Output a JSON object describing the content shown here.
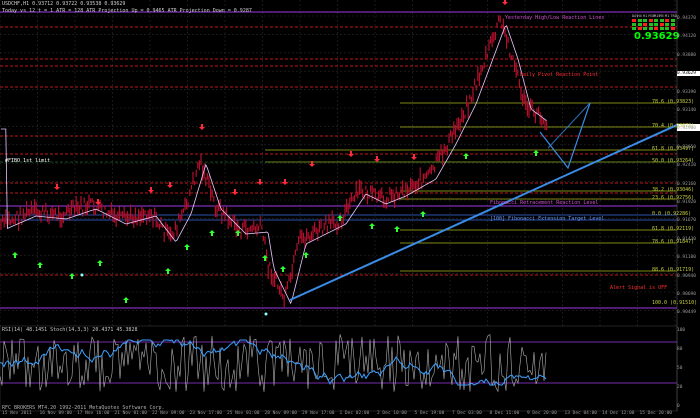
{
  "chart": {
    "title": "USDCHF,H1  0.93712 0.93722 0.93538 0.93629",
    "indicator_line": "Today vs 12 t = 1    ATR = 128    ATR Projection Up = 0.9465    ATR Projection Down = 0.9287",
    "big_price": "0.93629",
    "oscillator_label": "RSI(14) 48.1451  Stoch(14,3,3) 20.4371 45.3828",
    "footer_text": "RFC BROKERS MT4.20 1992-2011 MetaQuotes Software Corp.",
    "alert_text": "Alert Signal is OFF",
    "panel_labels": [
      "DAY",
      "H4",
      "H1",
      "M30",
      "M15",
      "M5",
      "M1",
      "TRD"
    ],
    "annotations": {
      "top": "Yesterday High/Low Reaction Lines",
      "mid1": "Daily Pivot Reaction Point",
      "fib_label": "#FIBO 1st limit",
      "lower_box": "Fibonacci Retracement Reaction Level",
      "lower_box2": "[100] Fibonacci Extension Target Level"
    },
    "fib_levels": [
      {
        "label": "78.6 (0.93823)"
      },
      {
        "label": "70.4 (0.93673)"
      },
      {
        "label": "61.8 (0.93497)"
      },
      {
        "label": "50.0 (0.93264)"
      },
      {
        "label": "38.2 (0.93046)"
      },
      {
        "label": "23.6 (0.92756)"
      },
      {
        "label": "0.0 (0.92286)"
      },
      {
        "label": "61.8 (0.92119)"
      },
      {
        "label": "78.6 (0.91847)"
      },
      {
        "label": "88.6 (0.91719)"
      },
      {
        "label": "100.0 (0.91510)"
      }
    ]
  },
  "price_axis": [
    "0.94370",
    "0.94120",
    "0.93880",
    "0.93629",
    "0.93390",
    "0.93140",
    "0.92900",
    "0.92650",
    "0.92410",
    "0.92160",
    "0.91920",
    "0.91670",
    "0.91430",
    "0.91180",
    "0.90940",
    "0.90690",
    "0.90449"
  ],
  "osc_axis": [
    "100",
    "80",
    "50",
    "20",
    "0"
  ],
  "time_axis": [
    "15 Nov 2011",
    "16 Nov 09:00",
    "17 Nov 16:00",
    "21 Nov 01:00",
    "22 Nov 09:00",
    "23 Nov 17:00",
    "25 Nov 01:00",
    "28 Nov 09:00",
    "29 Nov 17:00",
    "1 Dec 02:00",
    "2 Dec 10:00",
    "5 Dec 19:00",
    "7 Dec 03:00",
    "8 Dec 11:00",
    "9 Dec 20:00",
    "13 Dec 04:00",
    "14 Dec 12:00",
    "15 Dec 20:00"
  ],
  "colors": {
    "price_label_bg": "#00ff00",
    "candles": "#b0102c",
    "ma": "#e6c8ff",
    "trend": "#3a8ce6",
    "big_price": "#00ff00"
  }
}
